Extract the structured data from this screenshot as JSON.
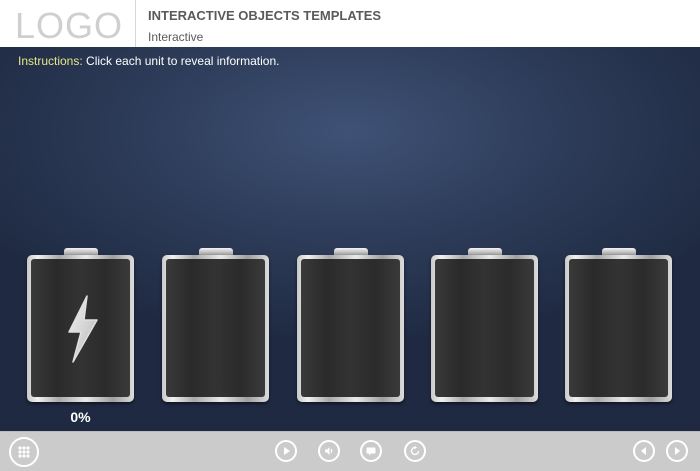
{
  "header": {
    "logo": "LOGO",
    "title": "INTERACTIVE OBJECTS TEMPLATES",
    "subtitle": "Interactive"
  },
  "instructions": {
    "lead": "Instructions:",
    "text": " Click each unit to reveal information."
  },
  "batteries": [
    {
      "icon": "lightning-bolt-icon",
      "charge_label": "0%"
    },
    {
      "icon": null,
      "charge_label": null
    },
    {
      "icon": null,
      "charge_label": null
    },
    {
      "icon": null,
      "charge_label": null
    },
    {
      "icon": null,
      "charge_label": null
    }
  ],
  "controls": {
    "menu": "grid-menu-icon",
    "play": "play-icon",
    "audio": "volume-icon",
    "captions": "captions-icon",
    "replay": "replay-icon",
    "previous": "previous-icon",
    "next": "next-icon"
  },
  "colors": {
    "accent_instructions": "#e6e68a",
    "stage_background": "#2f3e5c",
    "control_bar": "#cbcbcb"
  }
}
